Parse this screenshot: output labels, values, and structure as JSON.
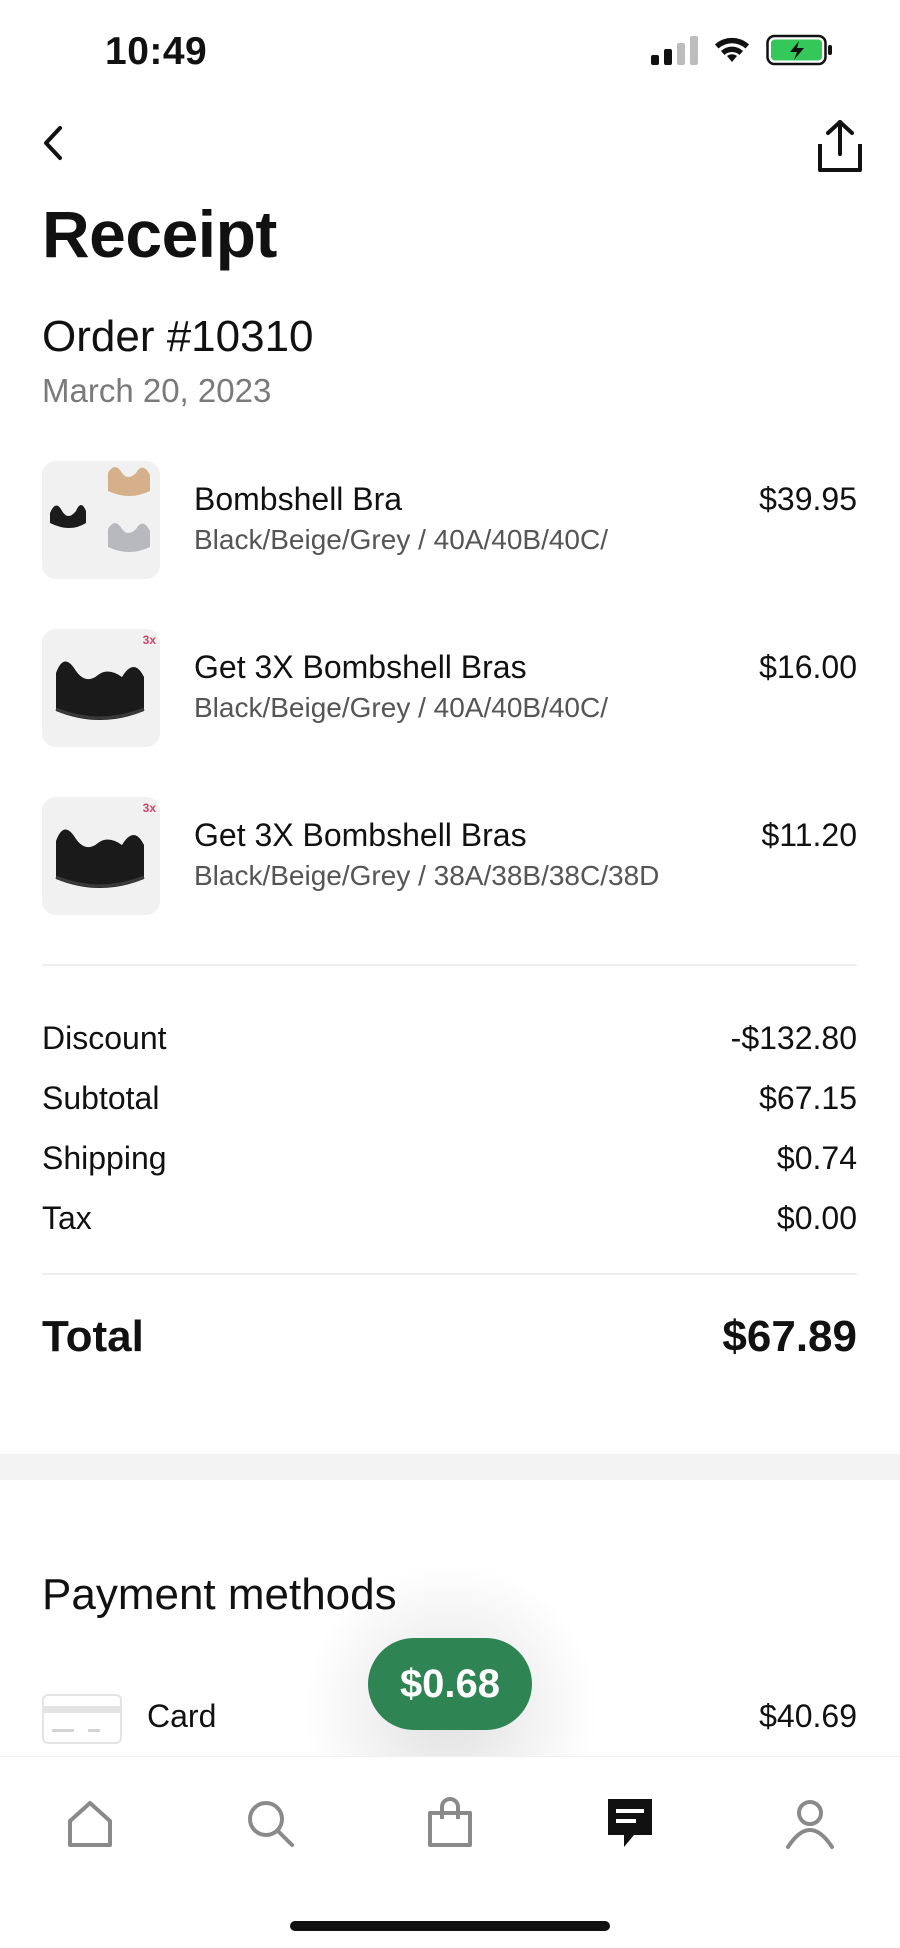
{
  "status_bar": {
    "time": "10:49",
    "battery_color": "#34c759"
  },
  "header": {
    "title": "Receipt",
    "back_icon": "chevron-left-icon",
    "share_icon": "share-icon"
  },
  "order": {
    "number": "Order #10310",
    "date": "March 20, 2023"
  },
  "items": [
    {
      "name": "Bombshell Bra",
      "variant": "Black/Beige/Grey / 40A/40B/40C/",
      "price": "$39.95"
    },
    {
      "name": "Get 3X Bombshell Bras",
      "variant": "Black/Beige/Grey / 40A/40B/40C/",
      "price": "$16.00"
    },
    {
      "name": "Get 3X Bombshell Bras",
      "variant": "Black/Beige/Grey / 38A/38B/38C/38D",
      "price": "$11.20"
    }
  ],
  "badge_text": "3x",
  "summary": [
    {
      "label": "Discount",
      "value": "-$132.80"
    },
    {
      "label": "Subtotal",
      "value": "$67.15"
    },
    {
      "label": "Shipping",
      "value": "$0.74"
    },
    {
      "label": "Tax",
      "value": "$0.00"
    }
  ],
  "total": {
    "label": "Total",
    "value": "$67.89"
  },
  "payment": {
    "title": "Payment methods",
    "methods": [
      {
        "label": "Card",
        "amount": "$40.69",
        "icon": "credit-card-icon"
      }
    ]
  },
  "floating_badge": {
    "text": "$0.68",
    "color": "#2f8453"
  },
  "bottom_nav": [
    {
      "name": "home",
      "icon": "home-icon",
      "active": false
    },
    {
      "name": "search",
      "icon": "search-icon",
      "active": false
    },
    {
      "name": "shop",
      "icon": "shopping-bag-icon",
      "active": false
    },
    {
      "name": "orders",
      "icon": "receipt-icon",
      "active": true
    },
    {
      "name": "account",
      "icon": "profile-icon",
      "active": false
    }
  ]
}
